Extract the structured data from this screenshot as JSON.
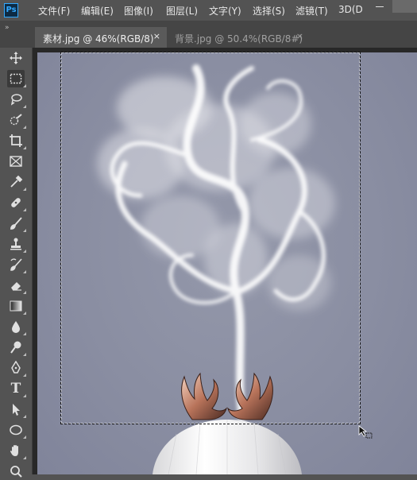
{
  "app": {
    "logo": "Ps"
  },
  "menu": {
    "items": [
      "文件(F)",
      "编辑(E)",
      "图像(I)",
      "图层(L)",
      "文字(Y)",
      "选择(S)",
      "滤镜(T)",
      "3D(D"
    ]
  },
  "window_controls": [
    "minimize",
    "maximize"
  ],
  "tabs": [
    {
      "label": "素材.jpg @ 46%(RGB/8)",
      "close": "×",
      "active": true
    },
    {
      "label": "背景.jpg @ 50.4%(RGB/8#)",
      "close": "×",
      "active": false
    }
  ],
  "toolbar": {
    "collapse": "»",
    "tools": [
      "move-icon",
      "rect-marquee-icon",
      "lasso-icon",
      "quick-select-icon",
      "crop-icon",
      "frame-icon",
      "eyedropper-icon",
      "healing-brush-icon",
      "brush-icon",
      "clone-stamp-icon",
      "history-brush-icon",
      "eraser-icon",
      "gradient-icon",
      "blur-icon",
      "dodge-icon",
      "pen-icon",
      "type-icon",
      "path-select-icon",
      "ellipse-icon",
      "hand-icon",
      "zoom-icon"
    ],
    "selected": "rect-marquee-icon",
    "type_tool_glyph": "T"
  },
  "colors": {
    "background": "#8a8ea2",
    "smoke": "#f2f2f4",
    "antler": "#c9856a",
    "lamp": "#f4f4f4"
  }
}
